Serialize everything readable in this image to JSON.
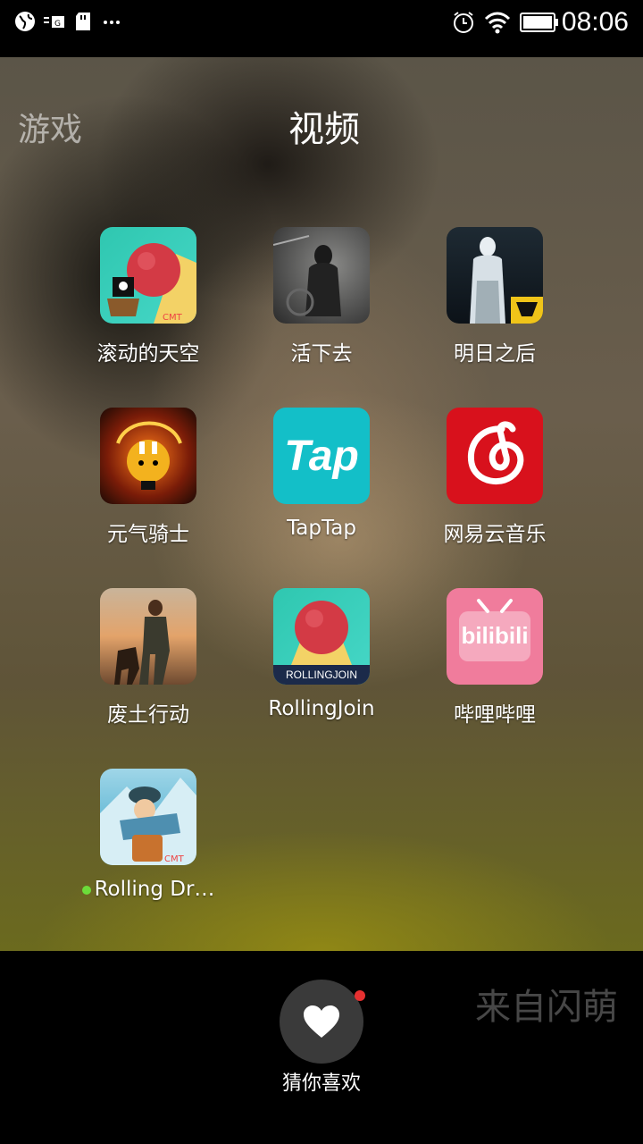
{
  "status_bar": {
    "time": "08:06",
    "left_icons": [
      "globe-icon",
      "sim-icon",
      "sd-card-icon",
      "more-icon"
    ],
    "right_icons": [
      "alarm-icon",
      "wifi-icon",
      "battery-icon"
    ]
  },
  "tabs": {
    "inactive": "游戏",
    "active": "视频"
  },
  "apps": [
    {
      "label": "滚动的天空"
    },
    {
      "label": "活下去"
    },
    {
      "label": "明日之后"
    },
    {
      "label": "元气骑士"
    },
    {
      "label": "TapTap",
      "icon_text": "Tap"
    },
    {
      "label": "网易云音乐"
    },
    {
      "label": "废土行动"
    },
    {
      "label": "RollingJoin",
      "icon_text": "ROLLINGJOIN"
    },
    {
      "label": "哔哩哔哩",
      "icon_text": "bilibili"
    },
    {
      "label": "Rolling Dr…",
      "has_new_dot": true
    }
  ],
  "dock": {
    "label": "猜你喜欢",
    "source": "来自闪萌",
    "has_notification_dot": true
  }
}
